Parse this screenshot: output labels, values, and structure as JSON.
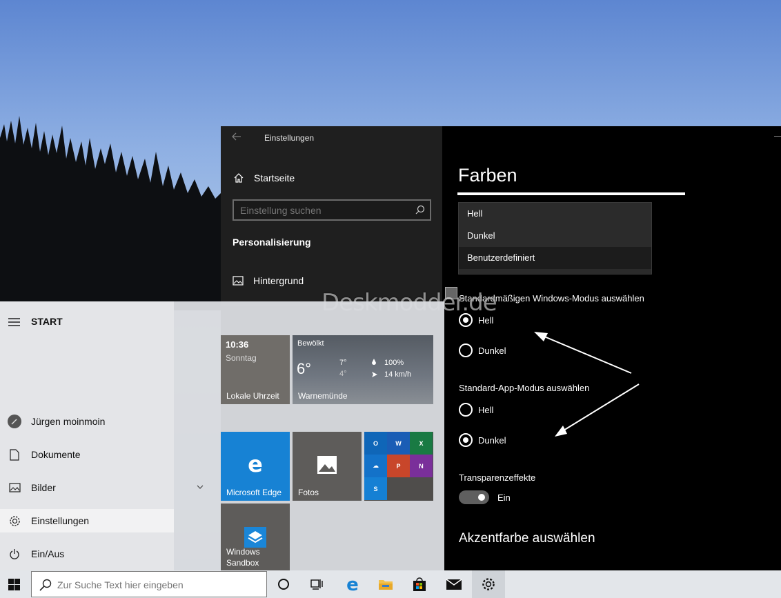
{
  "settings": {
    "window_title": "Einstellungen",
    "home_label": "Startseite",
    "search_placeholder": "Einstellung suchen",
    "section_label": "Personalisierung",
    "nav_item_label": "Hintergrund",
    "page_title": "Farben",
    "color_options": [
      "Hell",
      "Dunkel",
      "Benutzerdefiniert"
    ],
    "selected_color_option": "Benutzerdefiniert",
    "windows_mode_label": "Standardmäßigen Windows-Modus auswählen",
    "windows_mode_options": [
      {
        "label": "Hell",
        "checked": true
      },
      {
        "label": "Dunkel",
        "checked": false
      }
    ],
    "app_mode_label": "Standard-App-Modus auswählen",
    "app_mode_options": [
      {
        "label": "Hell",
        "checked": false
      },
      {
        "label": "Dunkel",
        "checked": true
      }
    ],
    "transparency_label": "Transparenzeffekte",
    "transparency_state": "Ein",
    "accent_title": "Akzentfarbe auswählen"
  },
  "watermark": "Deskmodder.de",
  "start_menu": {
    "header": "START",
    "user_name": "Jürgen moinmoin",
    "items": [
      "Dokumente",
      "Bilder",
      "Einstellungen",
      "Ein/Aus"
    ],
    "active_item": "Einstellungen",
    "tiles": {
      "clock": {
        "time": "10:36",
        "day": "Sonntag",
        "label": "Lokale Uhrzeit"
      },
      "weather": {
        "condition": "Bewölkt",
        "temp": "6°",
        "high": "7°",
        "low": "4°",
        "humidity": "100%",
        "wind": "14 km/h",
        "location": "Warnemünde"
      },
      "edge": {
        "label": "Microsoft Edge"
      },
      "photos": {
        "label": "Fotos"
      },
      "sandbox": {
        "label_line1": "Windows",
        "label_line2": "Sandbox"
      }
    }
  },
  "taskbar": {
    "search_placeholder": "Zur Suche Text hier eingeben",
    "icons": [
      "cortana-icon",
      "task-view-icon",
      "edge-icon",
      "file-explorer-icon",
      "store-icon",
      "mail-icon",
      "settings-gear-icon"
    ],
    "active_icon": "settings-gear-icon"
  },
  "colors": {
    "edge_tile": "#1782d4",
    "settings_background": "#000000",
    "settings_nav": "#1f1f1f",
    "taskbar": "#e3e6ea"
  }
}
